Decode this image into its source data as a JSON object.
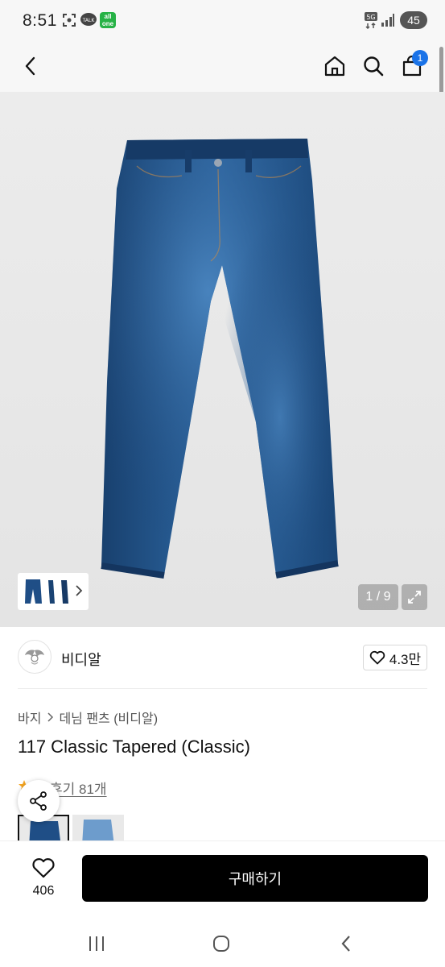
{
  "status_bar": {
    "time": "8:51",
    "notification_icons": [
      "screenshot-icon",
      "kakaotalk-icon",
      "chat-icon",
      "all-one-app-icon"
    ],
    "badge_text": "all one",
    "network": "5G",
    "battery": "45"
  },
  "nav": {
    "back": "back-arrow-icon",
    "home": "home-icon",
    "search": "search-icon",
    "cart": "shopping-bag-icon",
    "cart_count": "1"
  },
  "gallery": {
    "counter": "1 / 9",
    "expand": "expand-icon",
    "image": "dark blue denim tapered jeans"
  },
  "brand": {
    "name": "비디알",
    "likes": "4.3만"
  },
  "breadcrumb": {
    "category": "바지",
    "subcategory": "데님 팬츠 (비디알)"
  },
  "product": {
    "title": "117 Classic Tapered (Classic)",
    "reviews_label": "후기 81개"
  },
  "bottom_bar": {
    "wish_count": "406",
    "buy_label": "구매하기"
  },
  "colors": {
    "accent": "#1a73e8",
    "buy_button": "#000000",
    "denim": "#1f4e86"
  }
}
